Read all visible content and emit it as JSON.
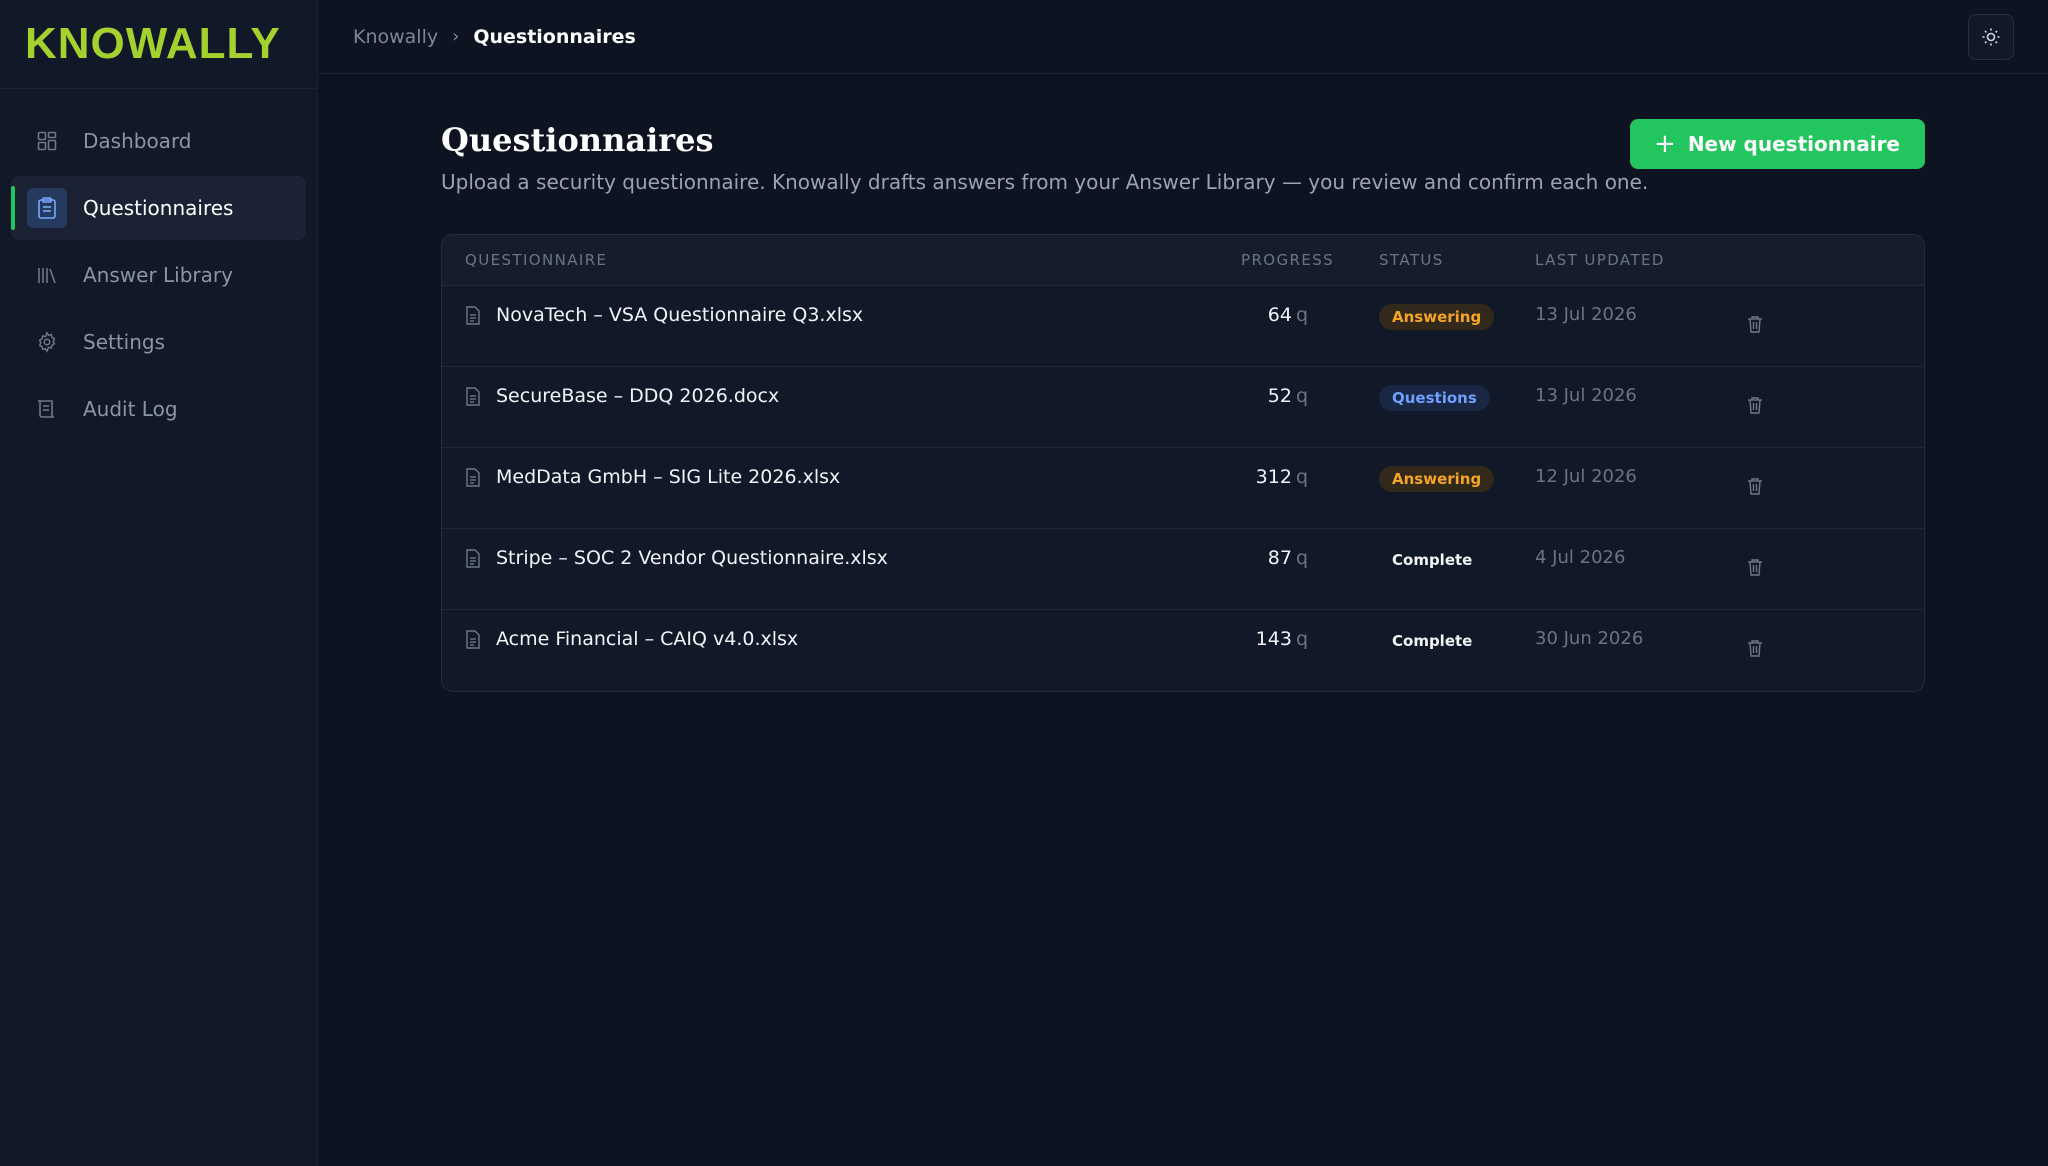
{
  "app": {
    "logo": "KNOWALLY",
    "brand_color": "#a3d12e",
    "accent_color": "#22c55e"
  },
  "sidebar": {
    "items": [
      {
        "label": "Dashboard",
        "icon": "dashboard-grid-icon",
        "active": false
      },
      {
        "label": "Questionnaires",
        "icon": "clipboard-icon",
        "active": true
      },
      {
        "label": "Answer Library",
        "icon": "library-books-icon",
        "active": false
      },
      {
        "label": "Settings",
        "icon": "gear-icon",
        "active": false
      },
      {
        "label": "Audit Log",
        "icon": "scroll-log-icon",
        "active": false
      }
    ]
  },
  "topbar": {
    "breadcrumb": {
      "root": "Knowally",
      "separator": "›",
      "current": "Questionnaires"
    },
    "theme_toggle_icon": "sun-icon"
  },
  "page": {
    "title": "Questionnaires",
    "subtitle": "Upload a security questionnaire. Knowally drafts answers from your Answer Library — you review and confirm each one.",
    "new_button": {
      "icon": "+",
      "label": "New questionnaire"
    }
  },
  "table": {
    "columns": {
      "questionnaire": "QUESTIONNAIRE",
      "progress": "PROGRESS",
      "status": "STATUS",
      "last_updated": "LAST UPDATED"
    },
    "rows": [
      {
        "name": "NovaTech – VSA Questionnaire Q3.xlsx",
        "count": "64",
        "unit": "q",
        "status": "Answering",
        "status_kind": "answering",
        "updated": "13 Jul 2026"
      },
      {
        "name": "SecureBase – DDQ 2026.docx",
        "count": "52",
        "unit": "q",
        "status": "Questions",
        "status_kind": "questions",
        "updated": "13 Jul 2026"
      },
      {
        "name": "MedData GmbH – SIG Lite 2026.xlsx",
        "count": "312",
        "unit": "q",
        "status": "Answering",
        "status_kind": "answering",
        "updated": "12 Jul 2026"
      },
      {
        "name": "Stripe – SOC 2 Vendor Questionnaire.xlsx",
        "count": "87",
        "unit": "q",
        "status": "Complete",
        "status_kind": "complete",
        "updated": "4 Jul 2026"
      },
      {
        "name": "Acme Financial – CAIQ v4.0.xlsx",
        "count": "143",
        "unit": "q",
        "status": "Complete",
        "status_kind": "complete",
        "updated": "30 Jun 2026"
      }
    ]
  }
}
